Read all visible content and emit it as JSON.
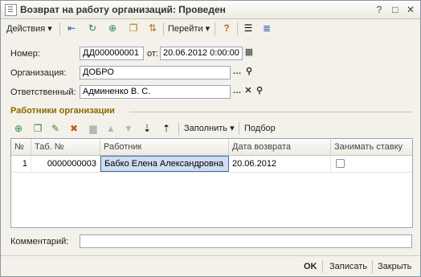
{
  "window": {
    "title": "Возврат на работу организаций: Проведен"
  },
  "toolbar": {
    "actions_label": "Действия",
    "goto_label": "Перейти"
  },
  "form": {
    "number_label": "Номер:",
    "number_value": "ДД000000001",
    "date_label": "от:",
    "date_value": "20.06.2012  0:00:00",
    "org_label": "Организация:",
    "org_value": "ДОБРО",
    "resp_label": "Ответственный:",
    "resp_value": "Админенко В. С.",
    "comment_label": "Комментарий:",
    "comment_value": ""
  },
  "section": {
    "title": "Работники организации"
  },
  "table_toolbar": {
    "fill_label": "Заполнить",
    "select_label": "Подбор"
  },
  "table": {
    "headers": [
      "№",
      "Таб. №",
      "Работник",
      "Дата возврата",
      "Занимать ставку"
    ],
    "rows": [
      {
        "num": "1",
        "tab": "0000000003",
        "employee": "Бабко Елена Александровна",
        "date": "20.06.2012",
        "take_rate": false
      }
    ]
  },
  "bottom": {
    "ok_label": "OK",
    "write_label": "Записать",
    "close_label": "Закрыть"
  }
}
